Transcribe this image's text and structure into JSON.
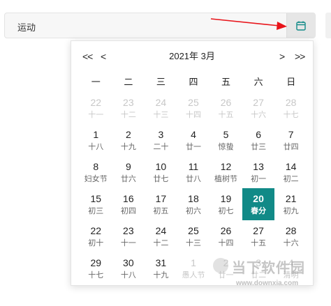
{
  "field": {
    "value": "运动"
  },
  "calendar": {
    "title": "2021年  3月",
    "nav": {
      "prev_year": "<<",
      "prev_month": "<",
      "next_month": ">",
      "next_year": ">>"
    },
    "weekdays": [
      "一",
      "二",
      "三",
      "四",
      "五",
      "六",
      "日"
    ],
    "days": [
      {
        "d": "22",
        "l": "十一",
        "other": true
      },
      {
        "d": "23",
        "l": "十二",
        "other": true
      },
      {
        "d": "24",
        "l": "十三",
        "other": true
      },
      {
        "d": "25",
        "l": "十四",
        "other": true
      },
      {
        "d": "26",
        "l": "十五",
        "other": true
      },
      {
        "d": "27",
        "l": "十六",
        "other": true
      },
      {
        "d": "28",
        "l": "十七",
        "other": true
      },
      {
        "d": "1",
        "l": "十八"
      },
      {
        "d": "2",
        "l": "十九"
      },
      {
        "d": "3",
        "l": "二十"
      },
      {
        "d": "4",
        "l": "廿一"
      },
      {
        "d": "5",
        "l": "惊蛰"
      },
      {
        "d": "6",
        "l": "廿三"
      },
      {
        "d": "7",
        "l": "廿四"
      },
      {
        "d": "8",
        "l": "妇女节"
      },
      {
        "d": "9",
        "l": "廿六"
      },
      {
        "d": "10",
        "l": "廿七"
      },
      {
        "d": "11",
        "l": "廿八"
      },
      {
        "d": "12",
        "l": "植树节"
      },
      {
        "d": "13",
        "l": "初一"
      },
      {
        "d": "14",
        "l": "初二"
      },
      {
        "d": "15",
        "l": "初三"
      },
      {
        "d": "16",
        "l": "初四"
      },
      {
        "d": "17",
        "l": "初五"
      },
      {
        "d": "18",
        "l": "初六"
      },
      {
        "d": "19",
        "l": "初七"
      },
      {
        "d": "20",
        "l": "春分",
        "selected": true
      },
      {
        "d": "21",
        "l": "初九"
      },
      {
        "d": "22",
        "l": "初十"
      },
      {
        "d": "23",
        "l": "十一"
      },
      {
        "d": "24",
        "l": "十二"
      },
      {
        "d": "25",
        "l": "十三"
      },
      {
        "d": "26",
        "l": "十四"
      },
      {
        "d": "27",
        "l": "十五"
      },
      {
        "d": "28",
        "l": "十六"
      },
      {
        "d": "29",
        "l": "十七"
      },
      {
        "d": "30",
        "l": "十八"
      },
      {
        "d": "31",
        "l": "十九"
      },
      {
        "d": "1",
        "l": "愚人节",
        "other": true
      },
      {
        "d": "2",
        "l": "廿一",
        "other": true
      },
      {
        "d": "3",
        "l": "廿二",
        "other": true
      },
      {
        "d": "4",
        "l": "清明",
        "other": true
      }
    ],
    "selected_color": "#118a87"
  },
  "icons": {
    "calendar_button": "calendar-icon",
    "annotation": "red-arrow"
  },
  "watermark": {
    "text": "当下软件园",
    "url": "www.downxia.com"
  }
}
